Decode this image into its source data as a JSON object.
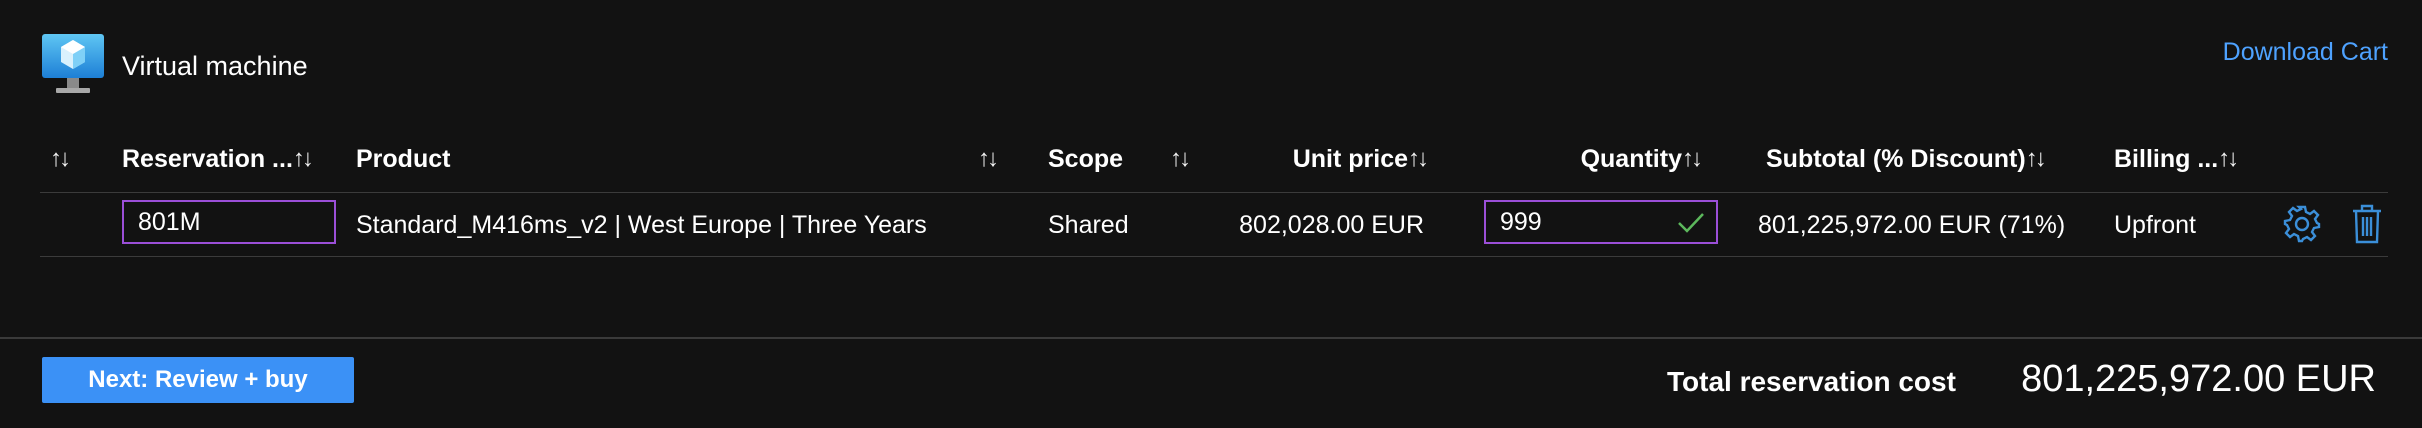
{
  "section": {
    "title": "Virtual machine",
    "icon": "virtual-machine-icon"
  },
  "actions": {
    "download_cart": "Download Cart"
  },
  "sort_icon": "↑↓",
  "table": {
    "headers": {
      "reservation": "Reservation ...",
      "product": "Product",
      "scope": "Scope",
      "unit_price": "Unit price",
      "quantity": "Quantity",
      "subtotal": "Subtotal (% Discount)",
      "billing": "Billing ..."
    },
    "rows": [
      {
        "reservation_name": "801M",
        "product": "Standard_M416ms_v2 | West Europe | Three Years",
        "scope": "Shared",
        "unit_price": "802,028.00 EUR",
        "quantity": "999",
        "subtotal": "801,225,972.00 EUR (71%)",
        "billing": "Upfront"
      }
    ]
  },
  "footer": {
    "next_button": "Next: Review + buy",
    "total_label": "Total reservation cost",
    "total_value": "801,225,972.00 EUR"
  },
  "colors": {
    "background": "#121212",
    "link": "#4ea2ff",
    "primary_button": "#3b91f6",
    "input_border": "#9b4fd8",
    "valid_check": "#5cb85c",
    "row_icon": "#3b8fd9"
  }
}
